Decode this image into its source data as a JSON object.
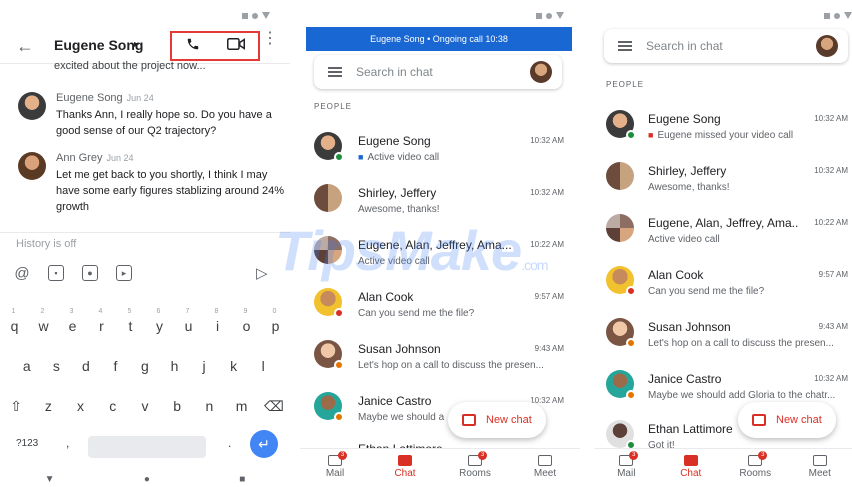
{
  "panel1": {
    "title": "Eugene Song",
    "caret": "▸",
    "back_icon": "arrow-back-icon",
    "preview": "excited about the project now...",
    "messages": [
      {
        "name": "Eugene Song",
        "date": "Jun 24",
        "body": "Thanks Ann, I really hope so. Do you have a good sense of our Q2 trajectory?"
      },
      {
        "name": "Ann Grey",
        "date": "Jun 24",
        "body": "Let me get back to you shortly, I think I may have some early figures stablizing around 24% growth"
      }
    ],
    "compose_hint": "History is off",
    "keyboard": {
      "row_numbers": [
        "1",
        "2",
        "3",
        "4",
        "5",
        "6",
        "7",
        "8",
        "9",
        "0"
      ],
      "row1": [
        "q",
        "w",
        "e",
        "r",
        "t",
        "y",
        "u",
        "i",
        "o",
        "p"
      ],
      "row2": [
        "a",
        "s",
        "d",
        "f",
        "g",
        "h",
        "j",
        "k",
        "l"
      ],
      "row3": [
        "z",
        "x",
        "c",
        "v",
        "b",
        "n",
        "m"
      ],
      "mode_key": "?123",
      "comma": ",",
      "period": "."
    }
  },
  "panel2": {
    "call_banner": "Eugene Song • Ongoing call 10:38",
    "search_placeholder": "Search in chat",
    "section": "PEOPLE",
    "rows": [
      {
        "name": "Eugene Song",
        "time": "10:32 AM",
        "sub": "Active video call",
        "sub_icon": "video-icon",
        "status": "green"
      },
      {
        "name": "Shirley, Jeffery",
        "time": "10:32 AM",
        "sub": "Awesome, thanks!",
        "status": ""
      },
      {
        "name": "Eugene, Alan, Jeffrey, Ama...",
        "time": "10:22 AM",
        "sub": "Active video call",
        "status": ""
      },
      {
        "name": "Alan Cook",
        "time": "9:57 AM",
        "sub": "Can you send me the file?",
        "status": "red"
      },
      {
        "name": "Susan Johnson",
        "time": "9:43 AM",
        "sub": "Let's hop on a call to discuss the presen...",
        "status": "orange"
      },
      {
        "name": "Janice Castro",
        "time": "10:32 AM",
        "sub": "Maybe we should a",
        "status": "orange"
      },
      {
        "name": "Ethan Lattimore",
        "time": "",
        "sub": "",
        "status": ""
      }
    ],
    "fab": "New chat"
  },
  "panel3": {
    "search_placeholder": "Search in chat",
    "section": "PEOPLE",
    "rows": [
      {
        "name": "Eugene Song",
        "time": "10:32 AM",
        "sub": "Eugene missed your video call",
        "sub_icon": "missed-video-icon",
        "status": "green"
      },
      {
        "name": "Shirley, Jeffery",
        "time": "10:32 AM",
        "sub": "Awesome, thanks!",
        "status": ""
      },
      {
        "name": "Eugene, Alan, Jeffrey, Ama...",
        "time": "10:22 AM",
        "sub": "Active video call",
        "status": ""
      },
      {
        "name": "Alan Cook",
        "time": "9:57 AM",
        "sub": "Can you send me the file?",
        "status": "red"
      },
      {
        "name": "Susan Johnson",
        "time": "9:43 AM",
        "sub": "Let's hop on a call to discuss the presen...",
        "status": "orange"
      },
      {
        "name": "Janice Castro",
        "time": "10:32 AM",
        "sub": "Maybe we should add Gloria to the chatr...",
        "status": "orange"
      },
      {
        "name": "Ethan Lattimore",
        "time": "",
        "sub": "Got it!",
        "status": "green"
      }
    ],
    "fab": "New chat"
  },
  "bottom_nav": [
    {
      "label": "Mail",
      "badge": "3"
    },
    {
      "label": "Chat",
      "badge": ""
    },
    {
      "label": "Rooms",
      "badge": "3"
    },
    {
      "label": "Meet",
      "badge": ""
    }
  ],
  "watermark": {
    "main": "TipsMake",
    "suffix": ".com"
  },
  "colors": {
    "accent_red": "#d93025",
    "banner_blue": "#1967d2",
    "enter_blue": "#4285f4",
    "online_green": "#1e8e3e"
  }
}
